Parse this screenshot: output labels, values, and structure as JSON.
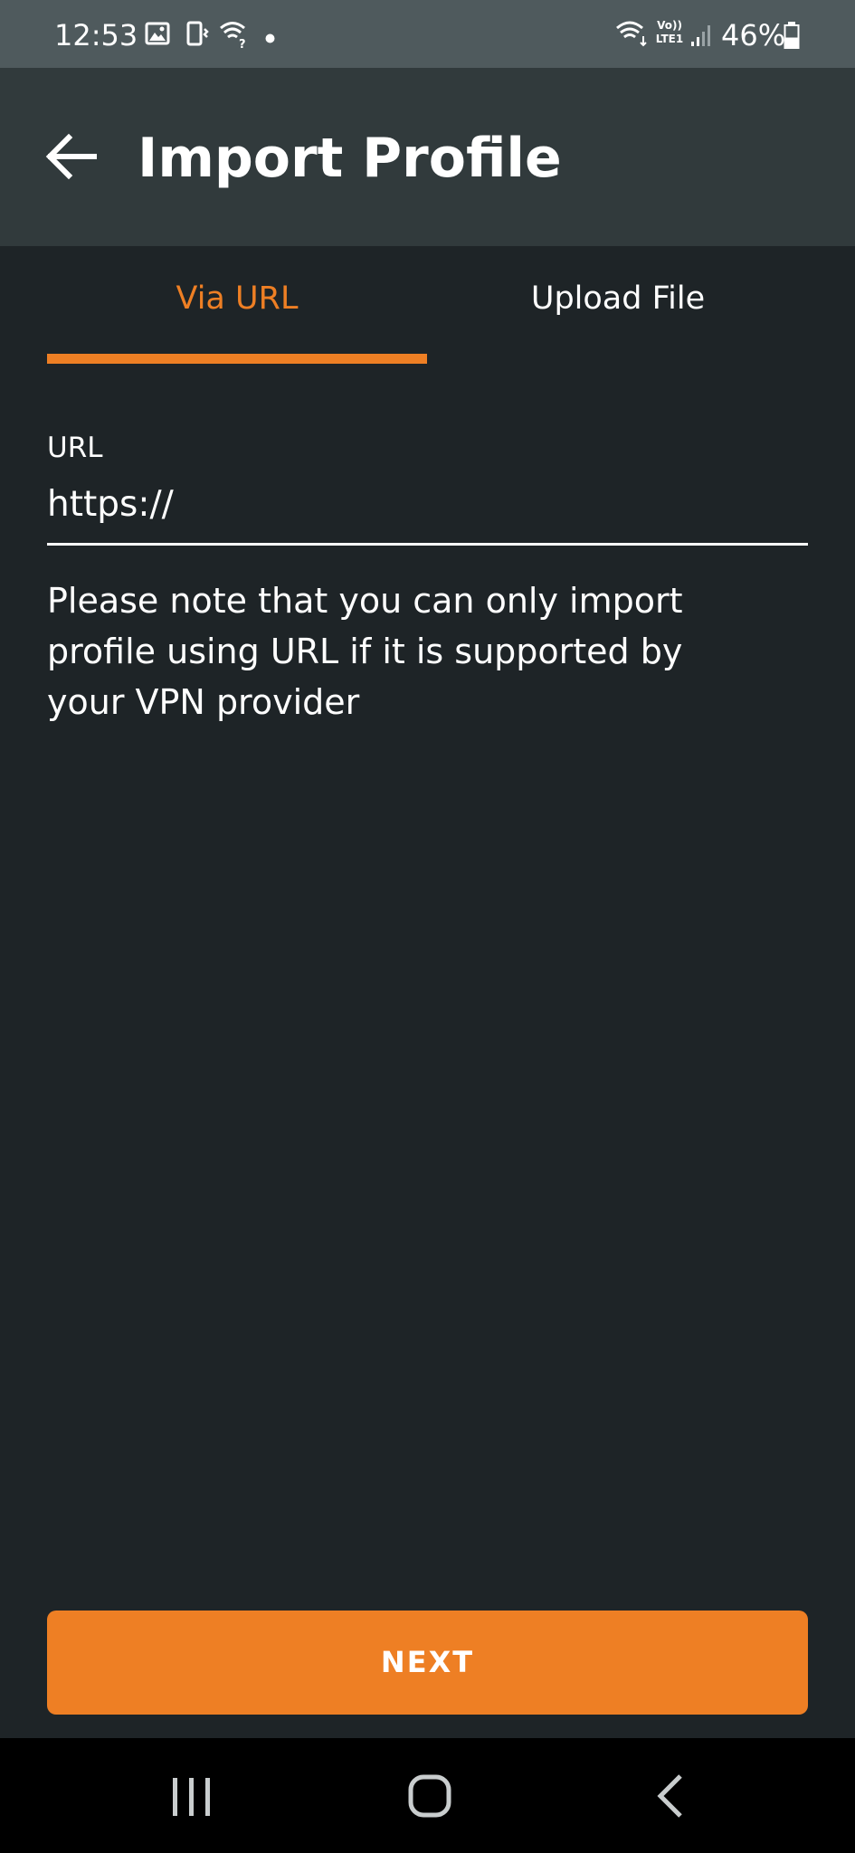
{
  "status_bar": {
    "time": "12:53",
    "volte_label": "Vo))",
    "lte_label": "LTE1",
    "battery_percent": "46%",
    "battery_level": 0.46,
    "icons": [
      "gallery-icon",
      "phone-vibrate-icon",
      "wifi-question-icon",
      "notification-dot-icon",
      "wifi-icon",
      "signal-icon",
      "battery-icon"
    ]
  },
  "app_bar": {
    "back_icon": "arrow-left-icon",
    "title": "Import Profile"
  },
  "tabs": [
    {
      "label": "Via URL",
      "selected": true
    },
    {
      "label": "Upload File",
      "selected": false
    }
  ],
  "url_field": {
    "label": "URL",
    "placeholder": "https://",
    "value": ""
  },
  "note": "Please note that you can only import profile using URL if it is supported by your VPN provider",
  "next_button": {
    "label": "NEXT"
  },
  "nav_bar": {
    "icons": [
      "recent-apps-icon",
      "home-icon",
      "back-chevron-icon"
    ]
  },
  "colors": {
    "accent": "#ee7f24",
    "background": "#1e2427",
    "app_bar": "#313a3c",
    "status_bar": "#4f5a5d",
    "text": "#ffffff"
  }
}
